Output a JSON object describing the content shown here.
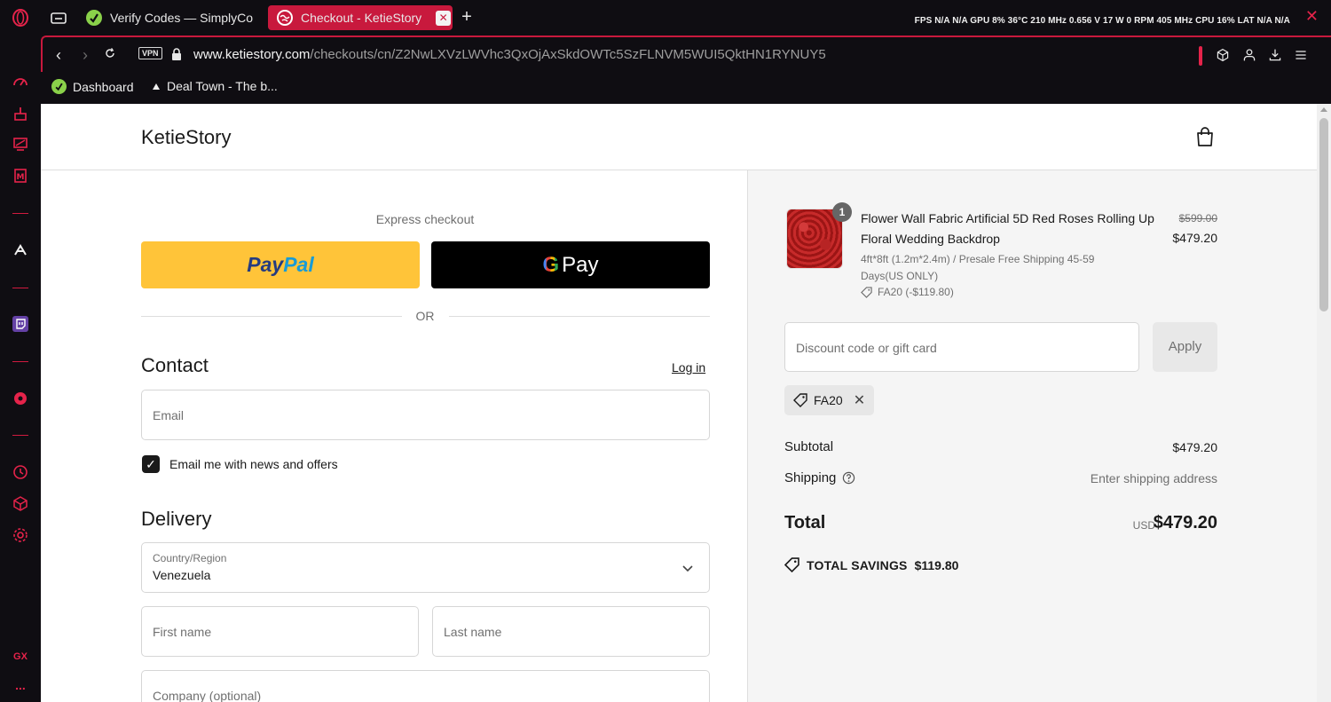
{
  "browser": {
    "tabs": [
      {
        "label": "Verify Codes — SimplyCo",
        "icon": "simplycodes-icon"
      },
      {
        "label": "Checkout - KetieStory",
        "icon": "globe-icon",
        "active": true
      }
    ],
    "hud": "FPS N/A  N/A GPU  8%  36°C 210 MHz 0.656 V  17 W  0 RPM  405 MHz CPU  16%  LAT  N/A  N/A",
    "vpn_label": "VPN",
    "url_domain": "www.ketiestory.com",
    "url_path": "/checkouts/cn/Z2NwLXVzLWVhc3QxOjAxSkdOWTc5SzFLNVM5WUI5QktHN1RYNUY5",
    "bookmarks": [
      {
        "label": "Dashboard",
        "icon": "simplycodes-icon"
      },
      {
        "label": "Deal Town - The b...",
        "icon": "dealtown-icon"
      }
    ],
    "sidebar_gx_label": "GX",
    "sidebar_more_label": "..."
  },
  "store": {
    "name": "KetieStory"
  },
  "express": {
    "title": "Express checkout",
    "paypal_part1": "Pay",
    "paypal_part2": "Pal",
    "gpay_g": "G",
    "gpay_label": "Pay",
    "or_label": "OR"
  },
  "contact": {
    "title": "Contact",
    "login_link": "Log in",
    "email_placeholder": "Email",
    "newsletter_label": "Email me with news and offers",
    "newsletter_checked": true
  },
  "delivery": {
    "title": "Delivery",
    "country_label": "Country/Region",
    "country_value": "Venezuela",
    "first_name_placeholder": "First name",
    "last_name_placeholder": "Last name",
    "company_placeholder": "Company (optional)"
  },
  "summary": {
    "item": {
      "quantity": "1",
      "name": "Flower Wall Fabric Artificial 5D Red Roses Rolling Up Floral Wedding Backdrop",
      "variant": "4ft*8ft  (1.2m*2.4m) / Presale Free Shipping 45-59 Days(US ONLY)",
      "discount": "FA20 (-$119.80)",
      "price_original": "$599.00",
      "price": "$479.20"
    },
    "discount_placeholder": "Discount code or gift card",
    "apply_label": "Apply",
    "applied_code": "FA20",
    "subtotal_label": "Subtotal",
    "subtotal_value": "$479.20",
    "shipping_label": "Shipping",
    "shipping_value": "Enter shipping address",
    "total_label": "Total",
    "currency": "USD",
    "total_value": "$479.20",
    "savings_label": "TOTAL SAVINGS",
    "savings_value": "$119.80"
  },
  "colors": {
    "accent": "#c8193d",
    "paypal_yellow": "#ffc439"
  }
}
